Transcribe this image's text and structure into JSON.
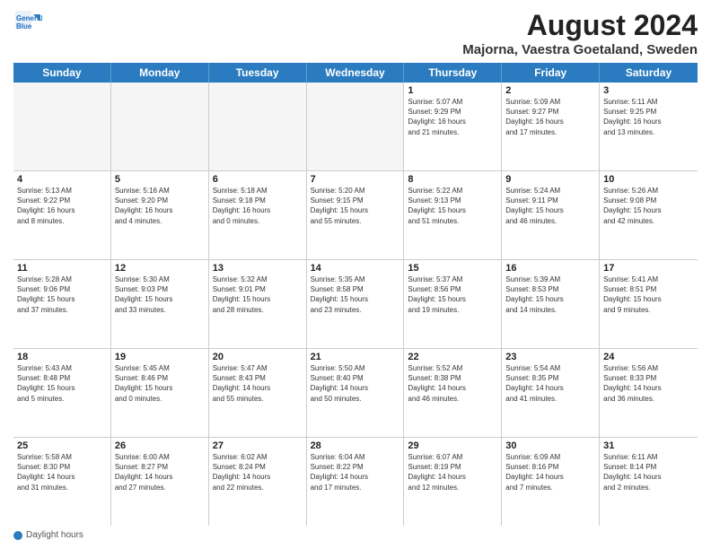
{
  "app": {
    "logo_line1": "General",
    "logo_line2": "Blue"
  },
  "title": "August 2024",
  "subtitle": "Majorna, Vaestra Goetaland, Sweden",
  "weekdays": [
    "Sunday",
    "Monday",
    "Tuesday",
    "Wednesday",
    "Thursday",
    "Friday",
    "Saturday"
  ],
  "footer_label": "Daylight hours",
  "weeks": [
    [
      {
        "day": "",
        "info": ""
      },
      {
        "day": "",
        "info": ""
      },
      {
        "day": "",
        "info": ""
      },
      {
        "day": "",
        "info": ""
      },
      {
        "day": "1",
        "info": "Sunrise: 5:07 AM\nSunset: 9:29 PM\nDaylight: 16 hours\nand 21 minutes."
      },
      {
        "day": "2",
        "info": "Sunrise: 5:09 AM\nSunset: 9:27 PM\nDaylight: 16 hours\nand 17 minutes."
      },
      {
        "day": "3",
        "info": "Sunrise: 5:11 AM\nSunset: 9:25 PM\nDaylight: 16 hours\nand 13 minutes."
      }
    ],
    [
      {
        "day": "4",
        "info": "Sunrise: 5:13 AM\nSunset: 9:22 PM\nDaylight: 16 hours\nand 8 minutes."
      },
      {
        "day": "5",
        "info": "Sunrise: 5:16 AM\nSunset: 9:20 PM\nDaylight: 16 hours\nand 4 minutes."
      },
      {
        "day": "6",
        "info": "Sunrise: 5:18 AM\nSunset: 9:18 PM\nDaylight: 16 hours\nand 0 minutes."
      },
      {
        "day": "7",
        "info": "Sunrise: 5:20 AM\nSunset: 9:15 PM\nDaylight: 15 hours\nand 55 minutes."
      },
      {
        "day": "8",
        "info": "Sunrise: 5:22 AM\nSunset: 9:13 PM\nDaylight: 15 hours\nand 51 minutes."
      },
      {
        "day": "9",
        "info": "Sunrise: 5:24 AM\nSunset: 9:11 PM\nDaylight: 15 hours\nand 46 minutes."
      },
      {
        "day": "10",
        "info": "Sunrise: 5:26 AM\nSunset: 9:08 PM\nDaylight: 15 hours\nand 42 minutes."
      }
    ],
    [
      {
        "day": "11",
        "info": "Sunrise: 5:28 AM\nSunset: 9:06 PM\nDaylight: 15 hours\nand 37 minutes."
      },
      {
        "day": "12",
        "info": "Sunrise: 5:30 AM\nSunset: 9:03 PM\nDaylight: 15 hours\nand 33 minutes."
      },
      {
        "day": "13",
        "info": "Sunrise: 5:32 AM\nSunset: 9:01 PM\nDaylight: 15 hours\nand 28 minutes."
      },
      {
        "day": "14",
        "info": "Sunrise: 5:35 AM\nSunset: 8:58 PM\nDaylight: 15 hours\nand 23 minutes."
      },
      {
        "day": "15",
        "info": "Sunrise: 5:37 AM\nSunset: 8:56 PM\nDaylight: 15 hours\nand 19 minutes."
      },
      {
        "day": "16",
        "info": "Sunrise: 5:39 AM\nSunset: 8:53 PM\nDaylight: 15 hours\nand 14 minutes."
      },
      {
        "day": "17",
        "info": "Sunrise: 5:41 AM\nSunset: 8:51 PM\nDaylight: 15 hours\nand 9 minutes."
      }
    ],
    [
      {
        "day": "18",
        "info": "Sunrise: 5:43 AM\nSunset: 8:48 PM\nDaylight: 15 hours\nand 5 minutes."
      },
      {
        "day": "19",
        "info": "Sunrise: 5:45 AM\nSunset: 8:46 PM\nDaylight: 15 hours\nand 0 minutes."
      },
      {
        "day": "20",
        "info": "Sunrise: 5:47 AM\nSunset: 8:43 PM\nDaylight: 14 hours\nand 55 minutes."
      },
      {
        "day": "21",
        "info": "Sunrise: 5:50 AM\nSunset: 8:40 PM\nDaylight: 14 hours\nand 50 minutes."
      },
      {
        "day": "22",
        "info": "Sunrise: 5:52 AM\nSunset: 8:38 PM\nDaylight: 14 hours\nand 46 minutes."
      },
      {
        "day": "23",
        "info": "Sunrise: 5:54 AM\nSunset: 8:35 PM\nDaylight: 14 hours\nand 41 minutes."
      },
      {
        "day": "24",
        "info": "Sunrise: 5:56 AM\nSunset: 8:33 PM\nDaylight: 14 hours\nand 36 minutes."
      }
    ],
    [
      {
        "day": "25",
        "info": "Sunrise: 5:58 AM\nSunset: 8:30 PM\nDaylight: 14 hours\nand 31 minutes."
      },
      {
        "day": "26",
        "info": "Sunrise: 6:00 AM\nSunset: 8:27 PM\nDaylight: 14 hours\nand 27 minutes."
      },
      {
        "day": "27",
        "info": "Sunrise: 6:02 AM\nSunset: 8:24 PM\nDaylight: 14 hours\nand 22 minutes."
      },
      {
        "day": "28",
        "info": "Sunrise: 6:04 AM\nSunset: 8:22 PM\nDaylight: 14 hours\nand 17 minutes."
      },
      {
        "day": "29",
        "info": "Sunrise: 6:07 AM\nSunset: 8:19 PM\nDaylight: 14 hours\nand 12 minutes."
      },
      {
        "day": "30",
        "info": "Sunrise: 6:09 AM\nSunset: 8:16 PM\nDaylight: 14 hours\nand 7 minutes."
      },
      {
        "day": "31",
        "info": "Sunrise: 6:11 AM\nSunset: 8:14 PM\nDaylight: 14 hours\nand 2 minutes."
      }
    ]
  ]
}
